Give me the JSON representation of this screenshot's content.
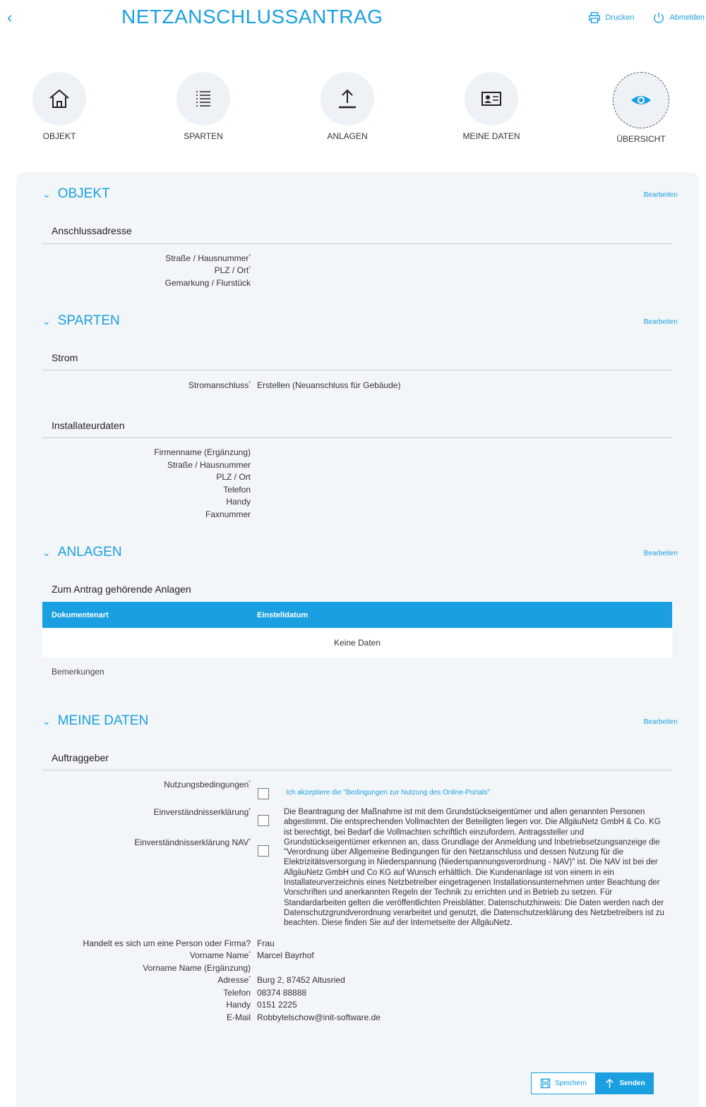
{
  "header": {
    "title": "NETZANSCHLUSSANTRAG",
    "print_label": "Drucken",
    "logout_label": "Abmelden"
  },
  "steps": [
    {
      "label": "OBJEKT",
      "icon": "home-icon"
    },
    {
      "label": "SPARTEN",
      "icon": "list-icon"
    },
    {
      "label": "ANLAGEN",
      "icon": "upload-icon"
    },
    {
      "label": "MEINE DATEN",
      "icon": "id-card-icon"
    },
    {
      "label": "ÜBERSICHT",
      "icon": "eye-icon",
      "active": true
    }
  ],
  "edit_label": "Bearbeiten",
  "objekt": {
    "title": "OBJEKT",
    "sub": "Anschlussadresse",
    "fields": [
      "Straße / Hausnummer",
      "PLZ / Ort",
      "Gemarkung / Flurstück"
    ]
  },
  "sparten": {
    "title": "SPARTEN",
    "sub_strom": "Strom",
    "strom_label": "Stromanschluss",
    "strom_value": "Erstellen (Neuanschluss für Gebäude)",
    "sub_inst": "Installateurdaten",
    "inst_fields": [
      "Firmenname (Ergänzung)",
      "Straße / Hausnummer",
      "PLZ / Ort",
      "Telefon",
      "Handy",
      "Faxnummer"
    ]
  },
  "anlagen": {
    "title": "ANLAGEN",
    "sub": "Zum Antrag gehörende Anlagen",
    "columns": [
      "Dokumentenart",
      "Einstelldatum"
    ],
    "empty": "Keine Daten",
    "remarks": "Bemerkungen"
  },
  "meine_daten": {
    "title": "MEINE DATEN",
    "sub": "Auftraggeber",
    "terms_label": "Nutzungsbedingungen",
    "terms_text": "Ich akzeptiere die \"Bedingungen zur Nutzung des Online-Portals\"",
    "consent_label": "Einverständnisserklärung",
    "consent_nav_label": "Einverständnisserklärung NAV",
    "legal_text": "Die Beantragung der Maßnahme ist mit dem Grundstückseigentümer und allen genannten Personen abgestimmt. Die entsprechenden Vollmachten der Beteiligten liegen vor. Die AllgäuNetz GmbH & Co. KG ist berechtigt, bei Bedarf die Vollmachten schriftlich einzufordern. Antragssteller und Grundstückseigentümer erkennen an, dass Grundlage der Anmeldung und Inbetriebsetzungsanzeige die \"Verordnung über Allgemeine Bedingungen für den Netzanschluss und dessen Nutzung für die Elektrizitätsversorgung in Niederspannung (Niederspannungsverordnung - NAV)\" ist. Die NAV ist bei der AllgäuNetz GmbH und Co KG auf Wunsch erhältlich. Die Kundenanlage ist von einem in ein Installateurverzeichnis eines Netzbetreiber eingetragenen Installationsunternehmen unter Beachtung der Vorschriften und anerkannten Regeln der Technik zu errichten und in Betrieb zu setzen. Für Standardarbeiten gelten die veröffentlichten Preisblätter. Datenschutzhinweis: Die Daten werden nach der Datenschutzgrundverordnung verarbeitet und genutzt, die Datenschutzerklärung des Netzbetreibers ist zu beachten. Diese finden Sie auf der Internetseite der AllgäuNetz.",
    "person_label": "Handelt es sich um eine Person oder Firma?",
    "person_value": "Frau",
    "name_label": "Vorname Name",
    "name_value": "Marcel Bayrhof",
    "name_ext_label": "Vorname Name (Ergänzung)",
    "address_label": "Adresse",
    "address_value": "Burg 2, 87452 Altusried",
    "phone_label": "Telefon",
    "phone_value": "08374 88888",
    "mobile_label": "Handy",
    "mobile_value": "0151 2225",
    "email_label": "E-Mail",
    "email_value": "Robbytelschow@init-software.de"
  },
  "actions": {
    "save_label": "Speichern",
    "send_label": "Senden"
  },
  "colors": {
    "accent": "#1a9fe0",
    "card_bg": "#f3f6f9"
  }
}
